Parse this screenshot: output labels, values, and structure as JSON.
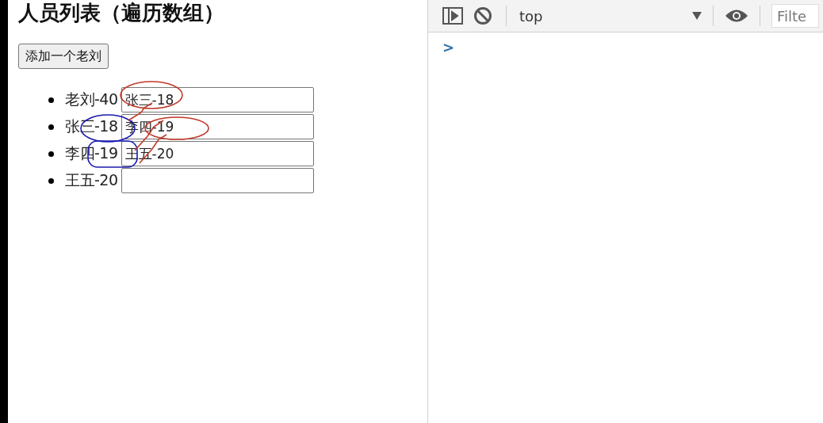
{
  "page": {
    "heading": "人员列表（遍历数组）",
    "add_button": "添加一个老刘",
    "people": [
      {
        "label": "老刘-40",
        "input_value": "张三-18"
      },
      {
        "label": "张三-18",
        "input_value": "李四-19"
      },
      {
        "label": "李四-19",
        "input_value": "王五-20"
      },
      {
        "label": "王五-20"
      }
    ]
  },
  "devtools": {
    "context": "top",
    "filter": {
      "placeholder": "Filte"
    },
    "prompt": ">"
  }
}
